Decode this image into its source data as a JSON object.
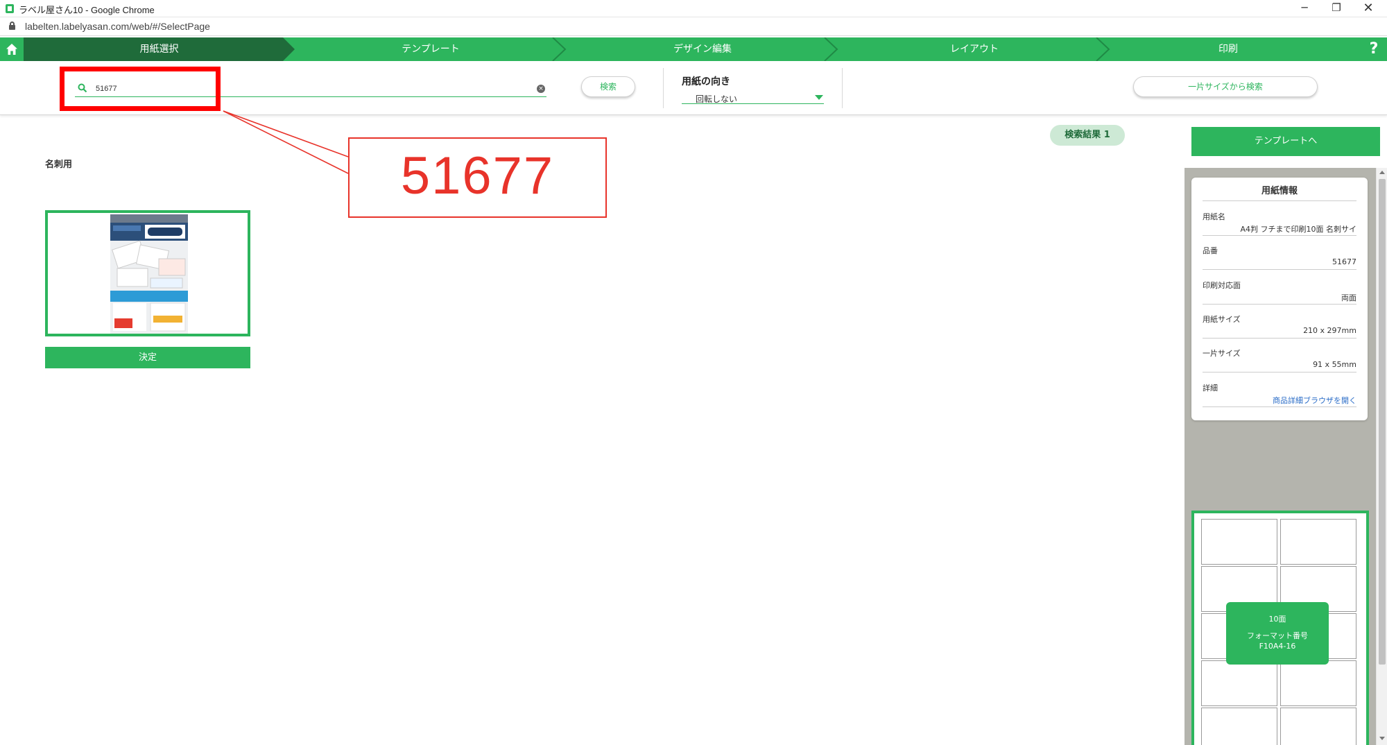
{
  "window": {
    "title": "ラベル屋さん10 - Google Chrome",
    "url": "labelten.labelyasan.com/web/#/SelectPage",
    "minimize_icon": "─",
    "restore_icon": "❐",
    "close_icon": "✕"
  },
  "steps": [
    {
      "label": "用紙選択",
      "active": true
    },
    {
      "label": "テンプレート",
      "active": false
    },
    {
      "label": "デザイン編集",
      "active": false
    },
    {
      "label": "レイアウト",
      "active": false
    },
    {
      "label": "印刷",
      "active": false
    }
  ],
  "help_label": "?",
  "search": {
    "value": "51677",
    "button_label": "検索",
    "clear_icon": "×"
  },
  "orientation": {
    "label": "用紙の向き",
    "value": "回転しない"
  },
  "size_search_label": "一片サイズから検索",
  "callout": {
    "text": "51677",
    "color": "#e8332a"
  },
  "results": {
    "badge": "検索結果 1",
    "category": "名刺用",
    "decide_label": "決定"
  },
  "side": {
    "to_template_label": "テンプレートへ",
    "info_title": "用紙情報",
    "rows": [
      {
        "label": "用紙名",
        "value": "A4判 フチまで印刷10面 名刺サイ"
      },
      {
        "label": "品番",
        "value": "51677"
      },
      {
        "label": "印刷対応面",
        "value": "両面"
      },
      {
        "label": "用紙サイズ",
        "value": "210 x 297mm"
      },
      {
        "label": "一片サイズ",
        "value": "91 x 55mm"
      },
      {
        "label": "詳細",
        "value": "商品詳細ブラウザを開く"
      }
    ],
    "format": {
      "count": "10面",
      "label": "フォーマット番号",
      "code": "F10A4-16"
    }
  },
  "colors": {
    "brand_green": "#2db55d",
    "active_step": "#1f6b3a",
    "highlight_red": "#ff0000",
    "panel_gray": "#b4b4ad"
  }
}
